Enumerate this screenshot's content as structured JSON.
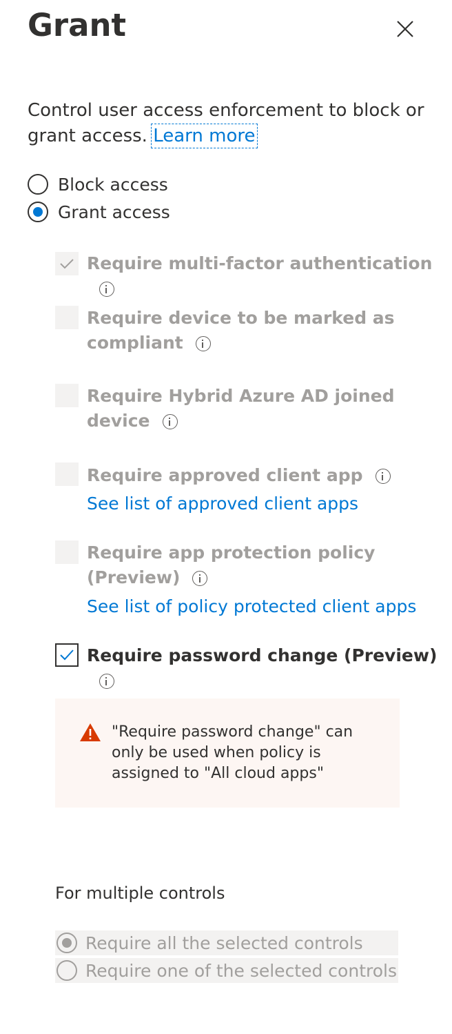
{
  "panel": {
    "title": "Grant",
    "description": "Control user access enforcement to block or grant access.",
    "learn_more": "Learn more"
  },
  "access": {
    "block_label": "Block access",
    "grant_label": "Grant access",
    "selected": "grant"
  },
  "controls": {
    "mfa": {
      "label": "Require multi-factor authentication",
      "checked": true,
      "disabled": true
    },
    "compliant_line1": "Require device to be marked as",
    "compliant_line2": "compliant",
    "hybrid_line1": "Require Hybrid Azure AD joined",
    "hybrid_line2": "device",
    "approved_app": "Require approved client app",
    "approved_link": "See list of approved client apps",
    "app_protection_line1": "Require app protection policy",
    "app_protection_line2": "(Preview)",
    "protection_link": "See list of policy protected client apps",
    "password_change": {
      "label": "Require password change (Preview)",
      "checked": true,
      "disabled": false
    }
  },
  "warning": {
    "text": "\"Require password change\" can only be used when policy is assigned to \"All cloud apps\"",
    "color": "#d83b01"
  },
  "multiple": {
    "label": "For multiple controls",
    "all_label": "Require all the selected controls",
    "one_label": "Require one of the selected controls",
    "selected": "all"
  },
  "colors": {
    "accent": "#0078d4",
    "disabled_text": "#a19f9d",
    "warning_bg": "#fdf6f3"
  }
}
